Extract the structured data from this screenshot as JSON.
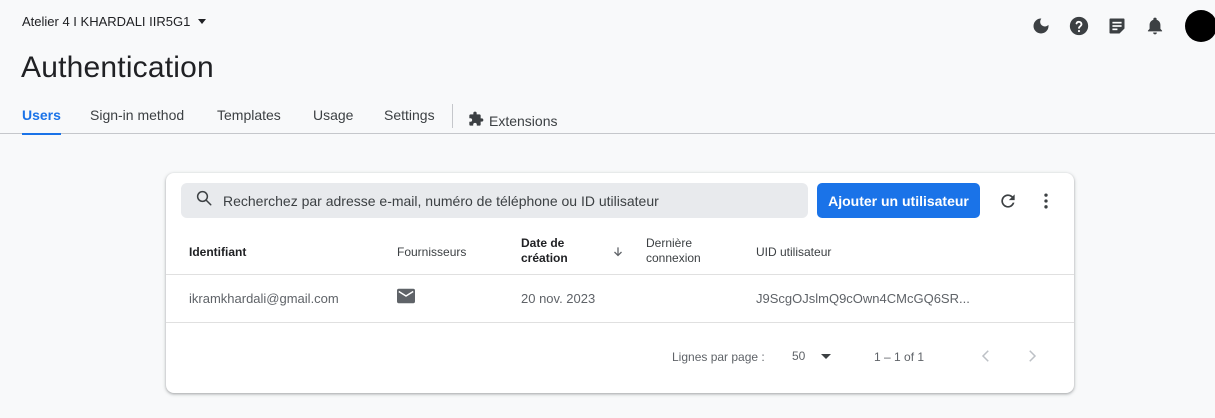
{
  "header": {
    "project_name": "Atelier 4 I KHARDALI IIR5G1",
    "icons": [
      "dark-mode-icon",
      "help-icon",
      "release-notes-icon",
      "notifications-icon",
      "avatar"
    ]
  },
  "page": {
    "title": "Authentication"
  },
  "tabs": [
    {
      "label": "Users",
      "active": true
    },
    {
      "label": "Sign-in method"
    },
    {
      "label": "Templates"
    },
    {
      "label": "Usage"
    },
    {
      "label": "Settings"
    },
    {
      "label": "Extensions",
      "icon": "extensions-icon"
    }
  ],
  "toolbar": {
    "search_placeholder": "Recherchez par adresse e-mail, numéro de téléphone ou ID utilisateur",
    "add_user_label": "Ajouter un utilisateur"
  },
  "table": {
    "columns": {
      "identifier": "Identifiant",
      "providers": "Fournisseurs",
      "created_line1": "Date de",
      "created_line2": "création",
      "last_login_line1": "Dernière",
      "last_login_line2": "connexion",
      "uid": "UID utilisateur"
    },
    "rows": [
      {
        "identifier": "ikramkhardali@gmail.com",
        "provider_icon": "email-icon",
        "created": "20 nov. 2023",
        "last_login": "",
        "uid": "J9ScgOJslmQ9cOwn4CMcGQ6SR..."
      }
    ]
  },
  "pagination": {
    "rows_per_page_label": "Lignes par page :",
    "rows_per_page_value": "50",
    "range": "1 – 1 of 1"
  },
  "colors": {
    "accent": "#1a73e8",
    "background": "#f8f9fa"
  }
}
